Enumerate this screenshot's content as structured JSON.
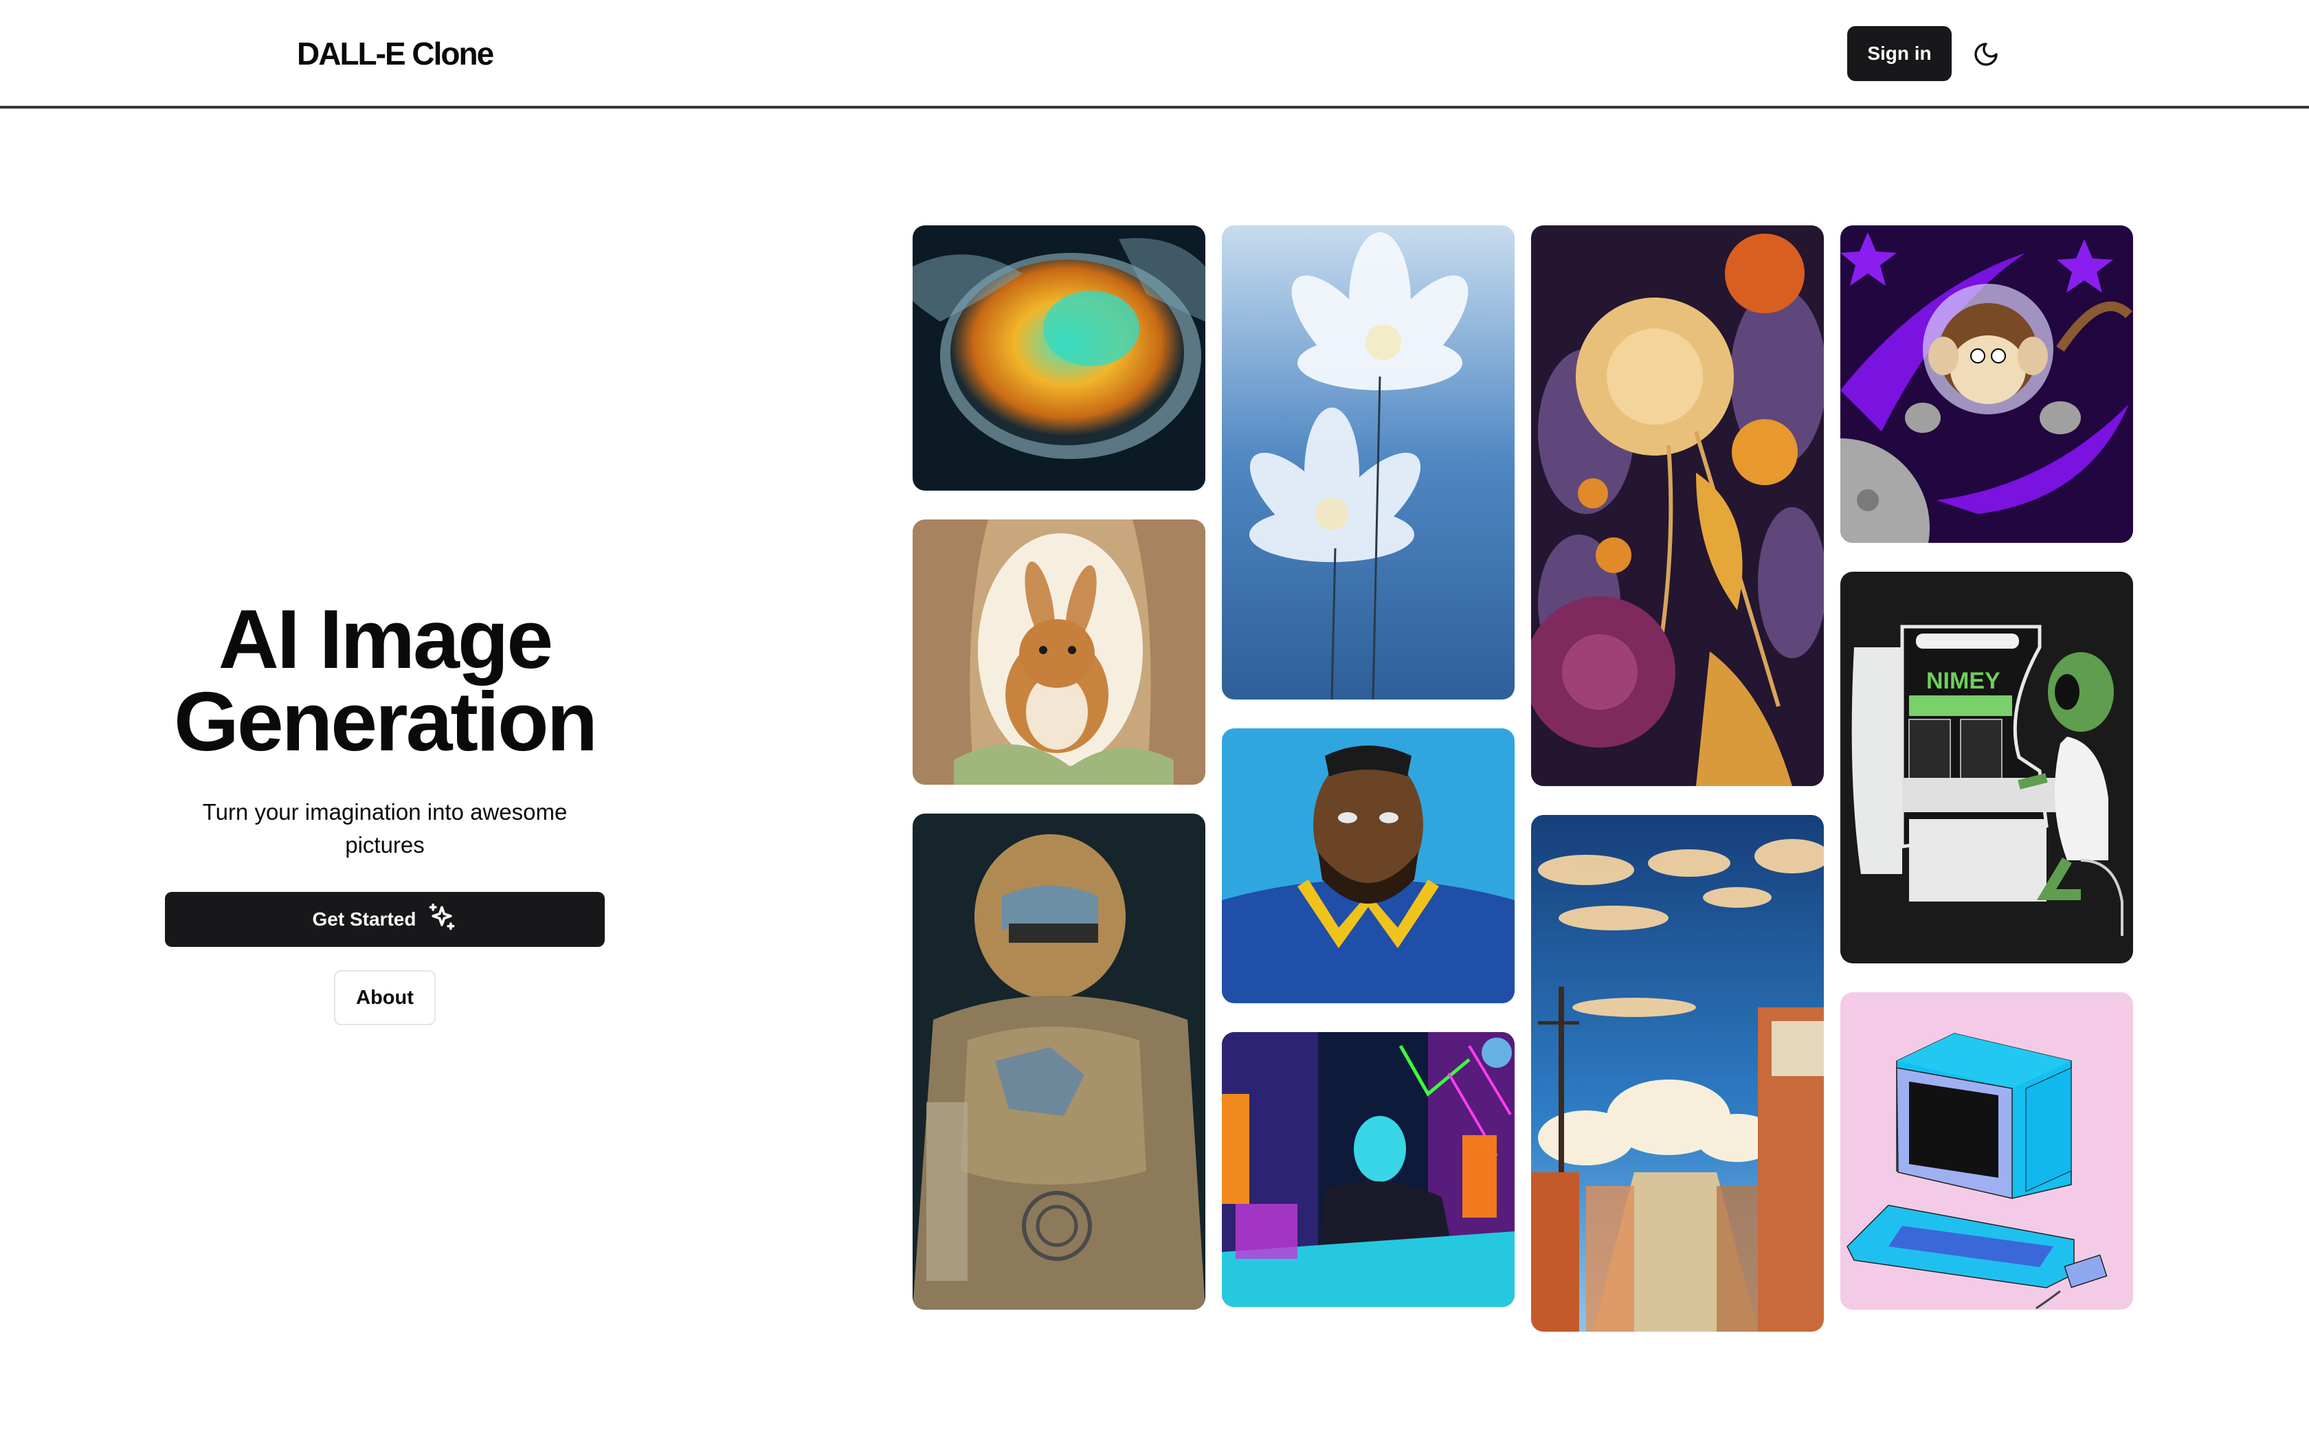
{
  "header": {
    "brand": "DALL-E Clone",
    "sign_in_label": "Sign in",
    "theme_icon": "moon-icon"
  },
  "hero": {
    "title_line1": "AI Image",
    "title_line2": "Generation",
    "subtitle": "Turn your imagination into awesome pictures",
    "cta_label": "Get Started",
    "cta_icon": "sparkles-icon",
    "about_label": "About"
  },
  "gallery": {
    "columns": [
      [
        {
          "id": "soup-bowl",
          "subject": "steaming bowl of soup with swirling smoke"
        },
        {
          "id": "bunny",
          "subject": "watercolor bunny in a tree hollow"
        },
        {
          "id": "robot",
          "subject": "rusty gold and blue robot"
        }
      ],
      [
        {
          "id": "white-flowers",
          "subject": "white lotus flowers on blue background"
        },
        {
          "id": "football-player",
          "subject": "painted portrait of football player in blue and gold jersey"
        },
        {
          "id": "neon-gamer",
          "subject": "cyberpunk gamer in neon-lit room"
        }
      ],
      [
        {
          "id": "chrysanthemums",
          "subject": "art-nouveau chrysanthemums in gold and purple"
        },
        {
          "id": "anime-street",
          "subject": "anime street with blue sky and clouds"
        }
      ],
      [
        {
          "id": "space-monkey",
          "subject": "cartoon monkey astronaut in purple space"
        },
        {
          "id": "alien-arcade",
          "subject": "green alien playing an arcade machine"
        },
        {
          "id": "retro-computer",
          "subject": "isometric retro computer on pink background"
        }
      ]
    ]
  },
  "colors": {
    "primary": "#18181b",
    "primary_text": "#fafafa",
    "border": "#e4e4e7",
    "header_rule": "#3a3a3a"
  }
}
